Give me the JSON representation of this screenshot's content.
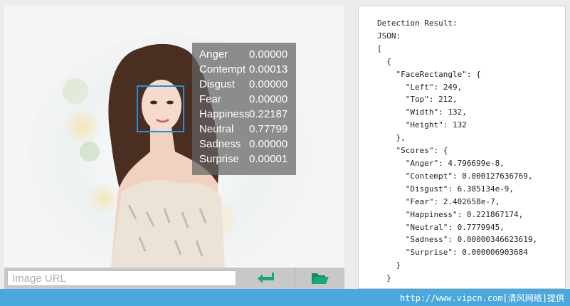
{
  "scores_overlay": [
    {
      "emotion": "Anger",
      "value": "0.00000"
    },
    {
      "emotion": "Contempt",
      "value": "0.00013"
    },
    {
      "emotion": "Disgust",
      "value": "0.00000"
    },
    {
      "emotion": "Fear",
      "value": "0.00000"
    },
    {
      "emotion": "Happiness",
      "value": "0.22187"
    },
    {
      "emotion": "Neutral",
      "value": "0.77799"
    },
    {
      "emotion": "Sadness",
      "value": "0.00000"
    },
    {
      "emotion": "Surprise",
      "value": "0.00001"
    }
  ],
  "input": {
    "placeholder": "Image URL",
    "value": ""
  },
  "buttons": {
    "submit_icon": "enter-arrow-icon",
    "browse_icon": "folder-open-icon"
  },
  "result_text": "Detection Result:\nJSON:\n[\n  {\n    \"FaceRectangle\": {\n      \"Left\": 249,\n      \"Top\": 212,\n      \"Width\": 132,\n      \"Height\": 132\n    },\n    \"Scores\": {\n      \"Anger\": 4.796699e-8,\n      \"Contempt\": 0.000127636769,\n      \"Disgust\": 6.385134e-9,\n      \"Fear\": 2.402658e-7,\n      \"Happiness\": 0.221867174,\n      \"Neutral\": 0.7779945,\n      \"Sadness\": 0.00000346623619,\n      \"Surprise\": 0.000006903684\n    }\n  }",
  "footer": {
    "text": "http://www.vipcn.com[清风网络]提供"
  },
  "colors": {
    "accent": "#19a77a",
    "face_box": "#1e90e0",
    "footer_bg": "#4aa8dc"
  }
}
